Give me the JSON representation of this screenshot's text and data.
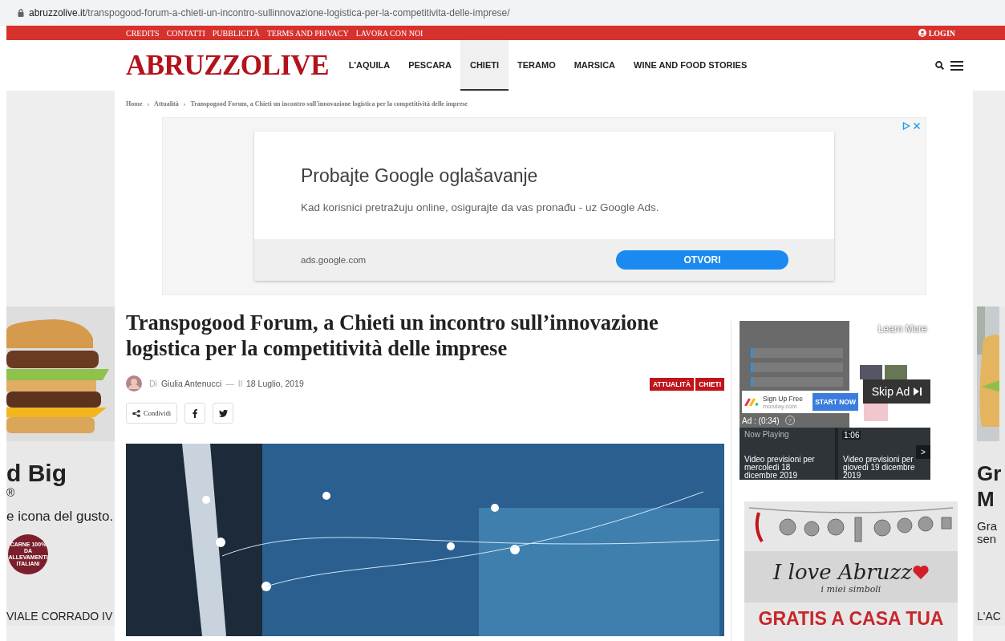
{
  "browser": {
    "url_domain": "abruzzolive.it",
    "url_path": "/transpogood-forum-a-chieti-un-incontro-sullinnovazione-logistica-per-la-competitivita-delle-imprese/"
  },
  "top_bar": {
    "links": [
      "CREDITS",
      "CONTATTI",
      "PUBBLICITÀ",
      "TERMS AND PRIVACY",
      "LAVORA CON NOI"
    ],
    "login": "LOGIN"
  },
  "header": {
    "logo": "ABRUZZOLIVE",
    "nav": [
      {
        "label": "L'AQUILA",
        "selected": false
      },
      {
        "label": "PESCARA",
        "selected": false
      },
      {
        "label": "CHIETI",
        "selected": true
      },
      {
        "label": "TERAMO",
        "selected": false
      },
      {
        "label": "MARSICA",
        "selected": false
      },
      {
        "label": "WINE AND FOOD STORIES",
        "selected": false
      }
    ]
  },
  "breadcrumb": {
    "separator": "›",
    "items": [
      "Home",
      "Attualità",
      "Transpogood Forum, a Chieti un incontro sull'innovazione logistica per la competitività delle imprese"
    ]
  },
  "google_ad": {
    "headline": "Probajte Google oglašavanje",
    "text": "Kad korisnici pretražuju online, osigurajte da vas pronađu - uz Google Ads.",
    "domain": "ads.google.com",
    "button": "OTVORI"
  },
  "article": {
    "title": "Transpogood Forum, a Chieti un incontro sull’innovazione logistica per la competitività delle imprese",
    "author_prefix": "Di",
    "author": "Giulia Antenucci",
    "separator": "—",
    "date_prefix": "Il",
    "date": "18 Luglio, 2019",
    "tags": [
      "ATTUALITÀ",
      "CHIETI"
    ],
    "share": "Condividi"
  },
  "video_ad": {
    "learn_more": "Learn More",
    "sign_up": "Sign Up Free",
    "sponsor": "monday.com",
    "cta": "START NOW",
    "skip": "Skip Ad",
    "timer": "Ad : (0:34)",
    "help": "?",
    "now_playing": "Now Playing",
    "duration": "1:06",
    "next": ">",
    "videos": [
      "Video previsioni per mercoledi 18 dicembre 2019",
      "Video previsioni per giovedi 19 dicembre 2019"
    ]
  },
  "banner_ad": {
    "title": "I love Abruzz",
    "subtitle": "i miei simboli",
    "offer": "GRATIS A CASA TUA"
  },
  "left_ad": {
    "headline": "d Big",
    "mark": "®",
    "text": "e icona del gusto.",
    "badge": "CARNE 100% DA ALLEVAMENTI ITALIANI",
    "address": "VIALE CORRADO IV"
  },
  "right_ad": {
    "headline": [
      "Gr",
      "M"
    ],
    "text": [
      "Gra",
      "sen"
    ],
    "address": "L'AC"
  }
}
